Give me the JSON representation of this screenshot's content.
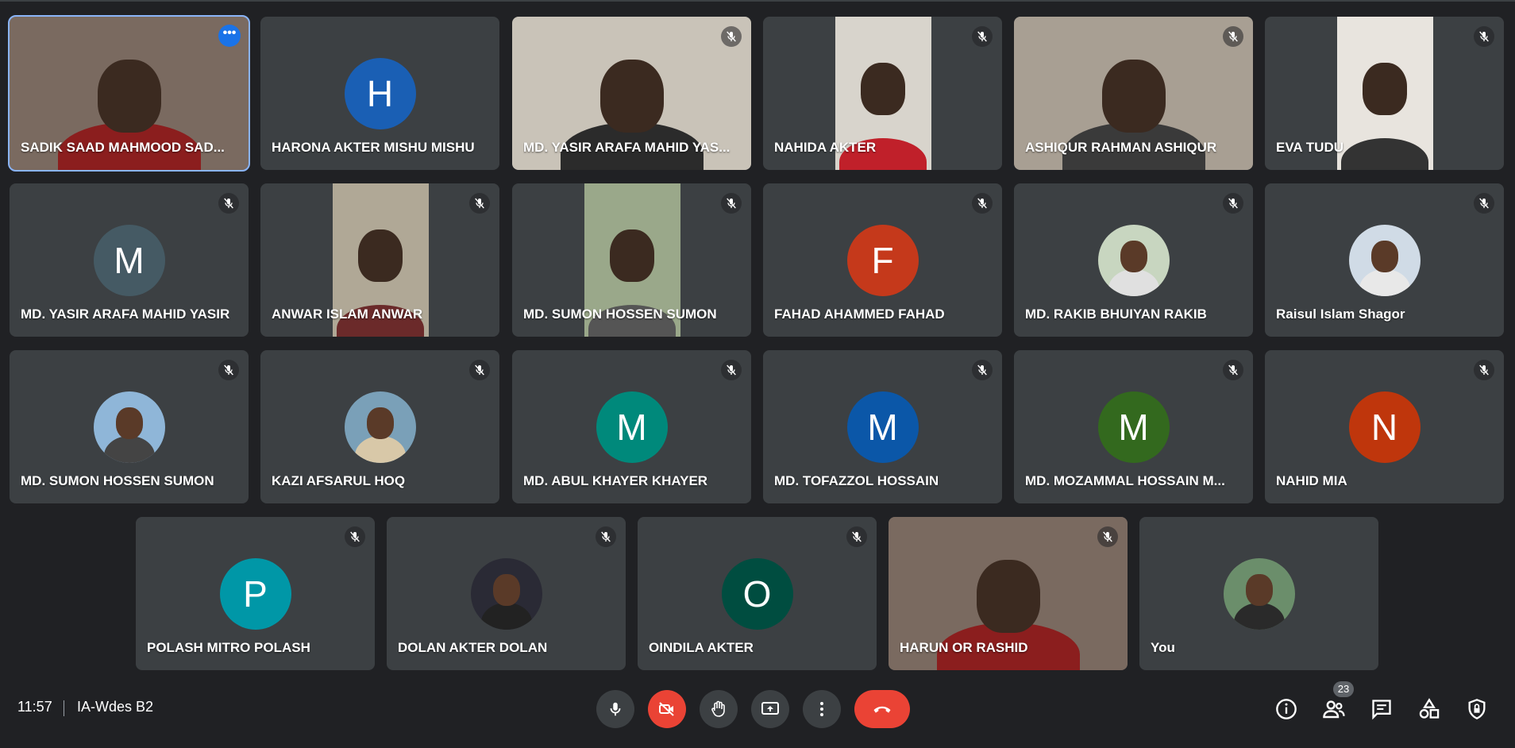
{
  "meeting": {
    "time": "11:57",
    "code": "IA-Wdes B2"
  },
  "colors": {
    "background": "#202124",
    "tile": "#3c4043",
    "active_outline": "#8ab4f8",
    "camera_off_red": "#ea4335",
    "more_button": "#1a73e8"
  },
  "participants": [
    {
      "name": "SADIK SAAD MAHMOOD SAD...",
      "kind": "video",
      "active": true,
      "has_more_menu": true
    },
    {
      "name": "HARONA AKTER MISHU MISHU",
      "kind": "letter",
      "initial": "H",
      "color": "#1a5fb4"
    },
    {
      "name": "MD. YASIR ARAFA MAHID YAS...",
      "kind": "video",
      "muted": true
    },
    {
      "name": "NAHIDA AKTER",
      "kind": "video-narrow",
      "muted": true
    },
    {
      "name": "ASHIQUR RAHMAN ASHIQUR",
      "kind": "video",
      "muted": true
    },
    {
      "name": "EVA TUDU",
      "kind": "video-narrow",
      "muted": true
    },
    {
      "name": "MD. YASIR ARAFA MAHID YASIR",
      "kind": "letter",
      "initial": "M",
      "color": "#455a64",
      "muted": true
    },
    {
      "name": "ANWAR ISLAM ANWAR",
      "kind": "video-narrow",
      "muted": true
    },
    {
      "name": "MD. SUMON HOSSEN SUMON",
      "kind": "video-narrow",
      "muted": true
    },
    {
      "name": "FAHAD AHAMMED FAHAD",
      "kind": "letter",
      "initial": "F",
      "color": "#c5391b",
      "muted": true
    },
    {
      "name": "MD. RAKIB BHUIYAN RAKIB",
      "kind": "photo",
      "muted": true
    },
    {
      "name": "Raisul Islam Shagor",
      "kind": "photo",
      "muted": true
    },
    {
      "name": "MD. SUMON HOSSEN SUMON",
      "kind": "photo",
      "muted": true
    },
    {
      "name": "KAZI AFSARUL HOQ",
      "kind": "photo",
      "muted": true
    },
    {
      "name": "MD. ABUL KHAYER KHAYER",
      "kind": "letter",
      "initial": "M",
      "color": "#00897b",
      "muted": true
    },
    {
      "name": "MD. TOFAZZOL HOSSAIN",
      "kind": "letter",
      "initial": "M",
      "color": "#0b57a8",
      "muted": true
    },
    {
      "name": "MD. MOZAMMAL HOSSAIN M...",
      "kind": "letter",
      "initial": "M",
      "color": "#33691e",
      "muted": true
    },
    {
      "name": "NAHID MIA",
      "kind": "letter",
      "initial": "N",
      "color": "#bf360c",
      "muted": true
    },
    {
      "name": "POLASH MITRO POLASH",
      "kind": "letter",
      "initial": "P",
      "color": "#0097a7",
      "muted": true
    },
    {
      "name": "DOLAN AKTER DOLAN",
      "kind": "photo",
      "muted": true
    },
    {
      "name": "OINDILA AKTER",
      "kind": "letter",
      "initial": "O",
      "color": "#004d40",
      "muted": true
    },
    {
      "name": "HARUN OR RASHID",
      "kind": "video",
      "muted": true
    },
    {
      "name": "You",
      "kind": "photo"
    }
  ],
  "controls": {
    "mic": "microphone-icon",
    "camera": "camera-off-icon",
    "hand": "raise-hand-icon",
    "present": "present-screen-icon",
    "more": "more-options-icon",
    "leave": "hang-up-icon"
  },
  "right_panel": {
    "people_count": "23",
    "icons": [
      "info-icon",
      "people-icon",
      "chat-icon",
      "activities-icon",
      "host-controls-icon"
    ]
  }
}
